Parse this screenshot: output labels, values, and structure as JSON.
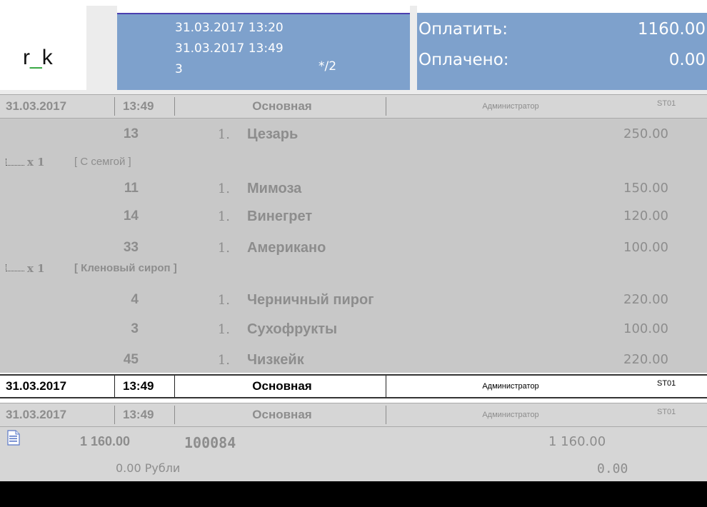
{
  "logo": {
    "prefix": "r",
    "underscore": "_",
    "suffix": "k"
  },
  "info": {
    "opened": "31.03.2017 13:20",
    "current": "31.03.2017 13:49",
    "guests": "3",
    "table": "*/2"
  },
  "payment": {
    "to_pay_label": "Оплатить:",
    "to_pay_value": "1160.00",
    "paid_label": "Оплачено:",
    "paid_value": "0.00"
  },
  "order_headers": [
    {
      "date": "31.03.2017",
      "time": "13:49",
      "hall": "Основная",
      "waiter": "Администратор",
      "station": "ST01"
    },
    {
      "date": "31.03.2017",
      "time": "13:49",
      "hall": "Основная",
      "waiter": "Администратор",
      "station": "ST01"
    },
    {
      "date": "31.03.2017",
      "time": "13:49",
      "hall": "Основная",
      "waiter": "Администратор",
      "station": "ST01"
    }
  ],
  "items": [
    {
      "code": "13",
      "qty": "1.",
      "name": "Цезарь",
      "price": "250.00"
    },
    {
      "code": "11",
      "qty": "1.",
      "name": "Мимоза",
      "price": "150.00"
    },
    {
      "code": "14",
      "qty": "1.",
      "name": "Винегрет",
      "price": "120.00"
    },
    {
      "code": "33",
      "qty": "1.",
      "name": "Американо",
      "price": "100.00"
    },
    {
      "code": "4",
      "qty": "1.",
      "name": "Черничный пирог",
      "price": "220.00"
    },
    {
      "code": "3",
      "qty": "1.",
      "name": "Сухофрукты",
      "price": "100.00"
    },
    {
      "code": "45",
      "qty": "1.",
      "name": "Чизкейк",
      "price": "220.00"
    }
  ],
  "modifiers": [
    {
      "qty": "x 1",
      "name": "[ С семгой ]"
    },
    {
      "qty": "x 1",
      "name": "[ Кленовый сироп ]"
    }
  ],
  "bill": {
    "amount": "1 160.00",
    "number": "100084",
    "total": "1 160.00",
    "paid": "0.00 Рубли",
    "paid_value": "0.00"
  },
  "icons": {
    "bill_doc": "document-icon"
  },
  "colors": {
    "panel": "#7ea1cc",
    "accent_line": "#4b3fb0",
    "logo_underscore": "#2ea43a"
  }
}
